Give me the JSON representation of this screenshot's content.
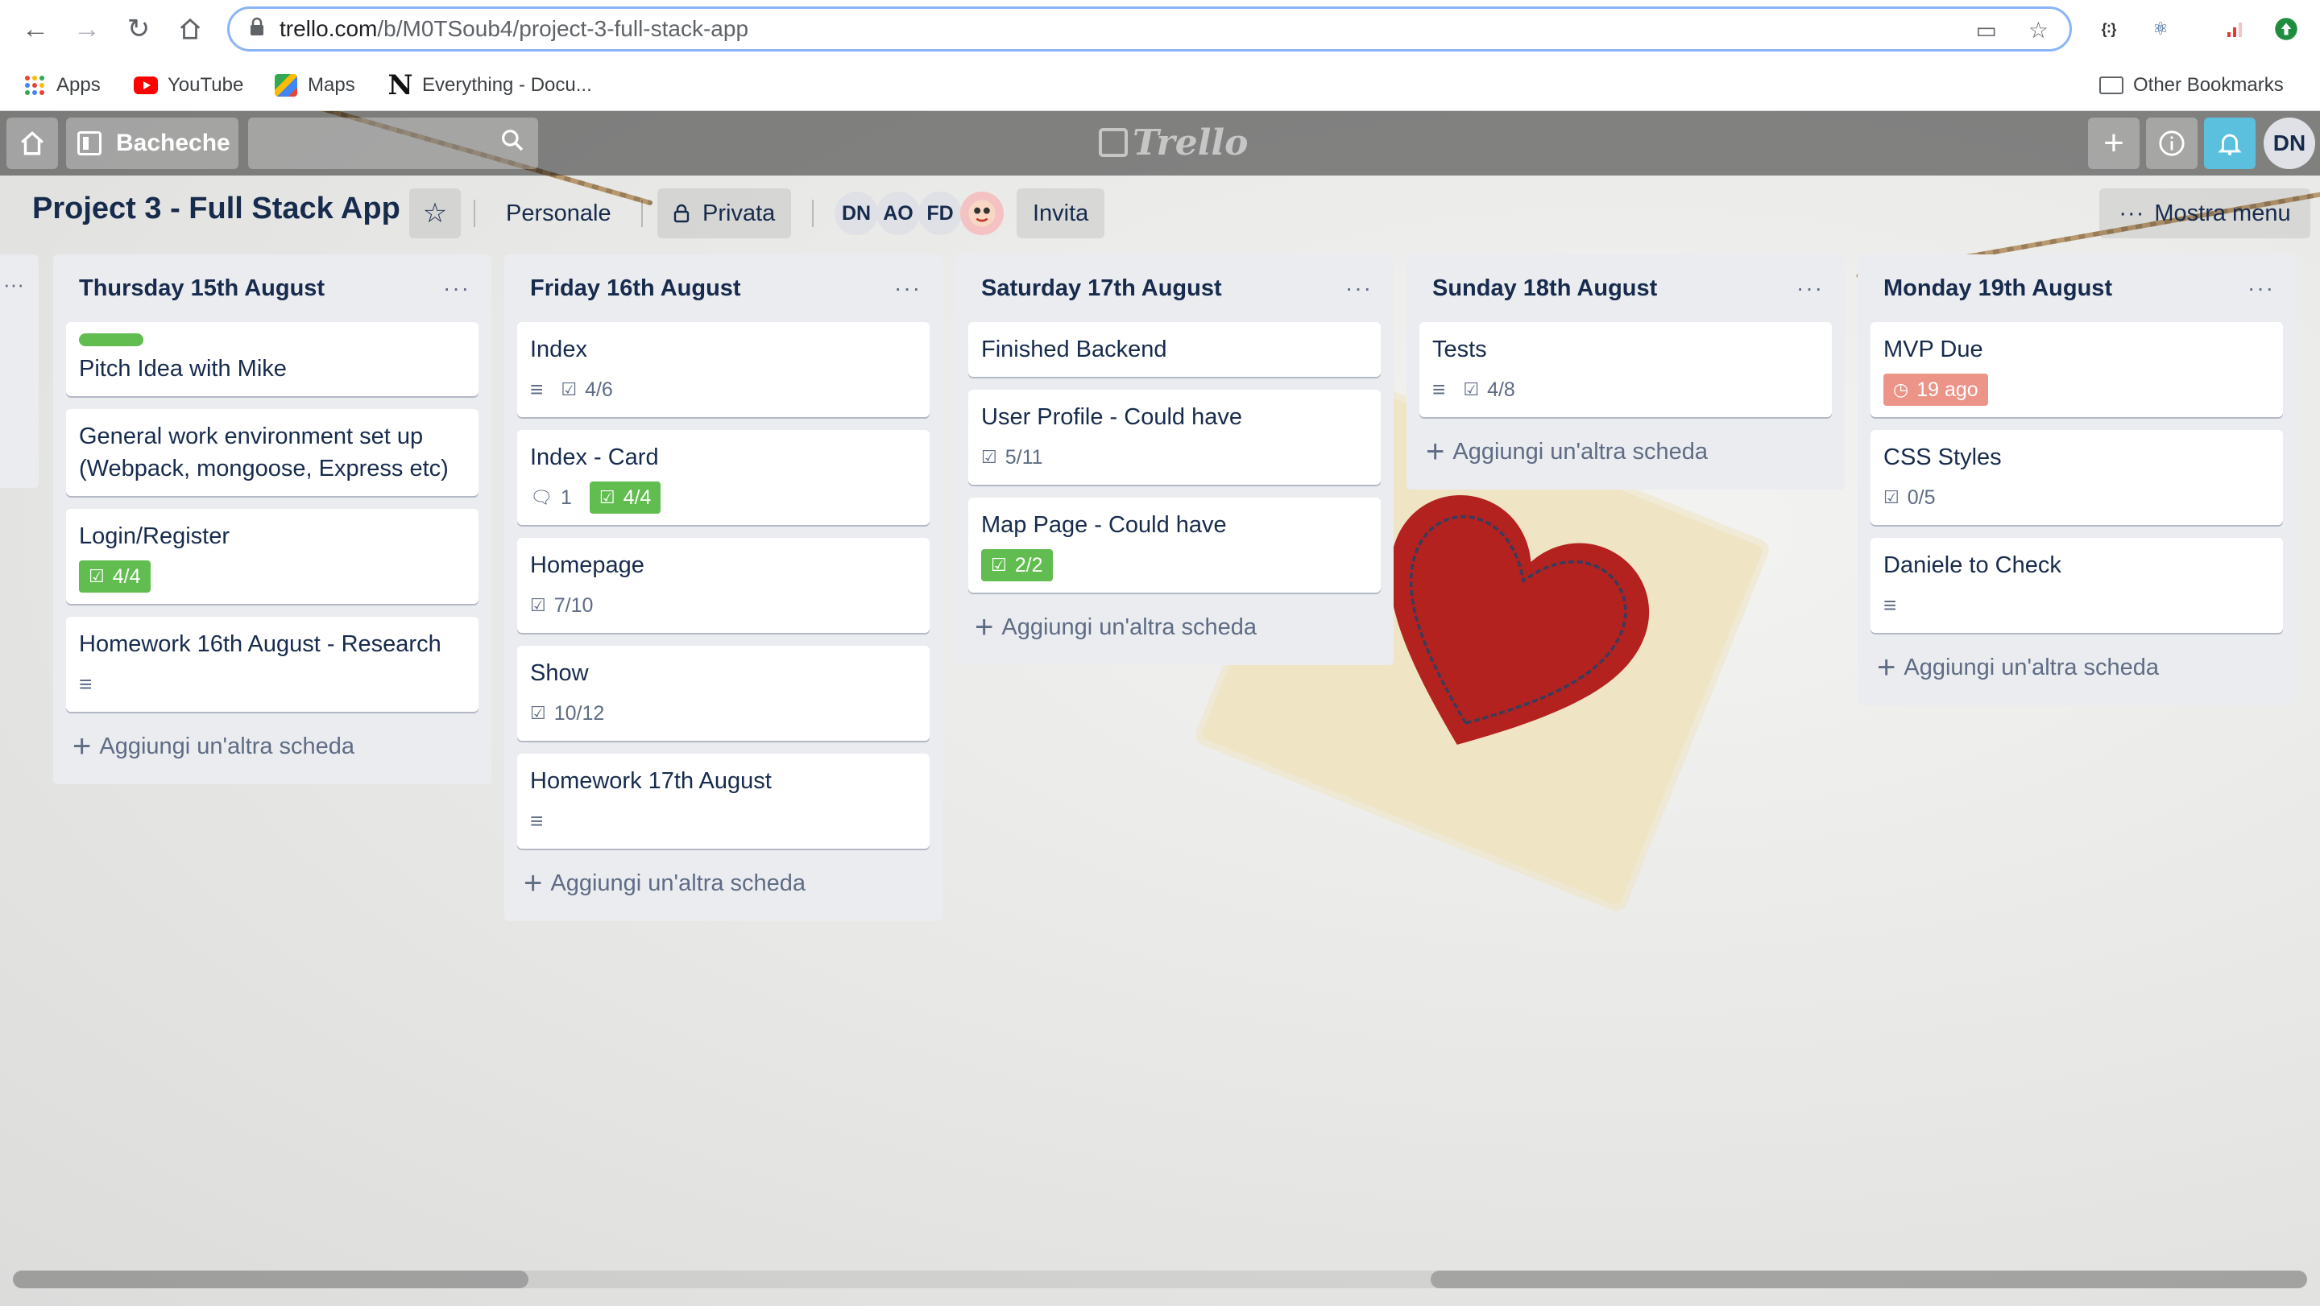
{
  "browser": {
    "url_host": "trello.com",
    "url_path": "/b/M0TSoub4/project-3-full-stack-app",
    "bookmarks": [
      {
        "label": "Apps",
        "icon": "apps-grid-icon"
      },
      {
        "label": "YouTube",
        "icon": "youtube-icon"
      },
      {
        "label": "Maps",
        "icon": "maps-icon"
      },
      {
        "label": "Everything - Docu...",
        "icon": "notion-icon"
      }
    ],
    "other_bookmarks": "Other Bookmarks"
  },
  "topbar": {
    "boards_label": "Bacheche",
    "logo_text": "Trello",
    "user_initials": "DN"
  },
  "boardbar": {
    "title": "Project 3 - Full Stack App",
    "team": "Personale",
    "visibility": "Privata",
    "members": [
      "DN",
      "AO",
      "FD"
    ],
    "invite": "Invita",
    "show_menu": "Mostra menu"
  },
  "lists": [
    {
      "title": "Thursday 15th August",
      "cards": [
        {
          "title": "Pitch Idea with Mike",
          "label_color": "#61bd4f"
        },
        {
          "title": "General work environment set up (Webpack, mongoose, Express etc)"
        },
        {
          "title": "Login/Register",
          "checklist": "4/4"
        },
        {
          "title": "Homework 16th August - Research"
        }
      ],
      "add": "Aggiungi un'altra scheda"
    },
    {
      "title": "Friday 16th August",
      "cards": [
        {
          "title": "Index",
          "checklist": "4/6"
        },
        {
          "title": "Index - Card",
          "comments": "1",
          "checklist": "4/4"
        },
        {
          "title": "Homepage",
          "checklist": "7/10"
        },
        {
          "title": "Show",
          "checklist": "10/12"
        },
        {
          "title": "Homework 17th August"
        }
      ],
      "add": "Aggiungi un'altra scheda"
    },
    {
      "title": "Saturday 17th August",
      "cards": [
        {
          "title": "Finished Backend"
        },
        {
          "title": "User Profile - Could have",
          "checklist": "5/11"
        },
        {
          "title": "Map Page - Could have",
          "checklist": "2/2"
        }
      ],
      "add": "Aggiungi un'altra scheda"
    },
    {
      "title": "Sunday 18th August",
      "cards": [
        {
          "title": "Tests",
          "checklist": "4/8"
        }
      ],
      "add": "Aggiungi un'altra scheda"
    },
    {
      "title": "Monday 19th August",
      "cards": [
        {
          "title": "MVP Due",
          "due": "19 ago"
        },
        {
          "title": "CSS Styles",
          "checklist": "0/5"
        },
        {
          "title": "Daniele to Check"
        }
      ],
      "add": "Aggiungi un'altra scheda"
    }
  ],
  "colors": {
    "complete_green": "#61bd4f",
    "overdue_red": "#ec9488",
    "list_bg": "#ebecf0",
    "text_dark": "#172b4d",
    "notification_blue": "#5bc0de"
  }
}
